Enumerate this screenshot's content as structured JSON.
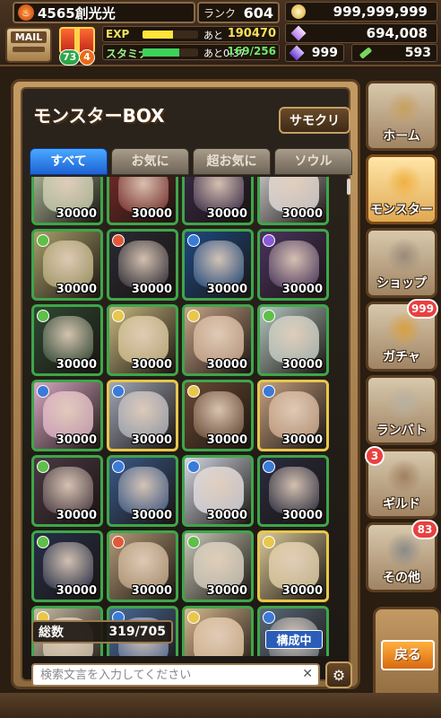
{
  "player": {
    "flame_icon": "flame-icon",
    "name": "4565創光光",
    "rank_label": "ランク",
    "rank": "604"
  },
  "mail": {
    "label": "MAIL"
  },
  "gift": {
    "badge_green": "73",
    "badge_orange": "4"
  },
  "exp": {
    "label": "EXP",
    "ato": "あと",
    "remaining": "190470",
    "fill_fraction": 0.55
  },
  "stamina": {
    "label": "スタミナ",
    "timer": "あと0:37",
    "value": "169/256",
    "fill_fraction": 0.66
  },
  "currency": {
    "coins": "999,999,999",
    "gems": "694,008",
    "crystals": "999",
    "items": "593"
  },
  "panel": {
    "title": "モンスターBOX",
    "sort_button": "サモクリ"
  },
  "tabs": [
    {
      "label": "すべて",
      "active": true
    },
    {
      "label": "お気に",
      "active": false
    },
    {
      "label": "超お気に",
      "active": false
    },
    {
      "label": "ソウル",
      "active": false
    }
  ],
  "monsters": [
    {
      "value": "30000",
      "border": "#3ea64a",
      "elem": "#5fbf4a",
      "bg": "#b7c6a4"
    },
    {
      "value": "30000",
      "border": "#3ea64a",
      "elem": "#e05a3a",
      "bg": "#7a2c2a"
    },
    {
      "value": "30000",
      "border": "#3ea64a",
      "elem": "#8a5ad8",
      "bg": "#3a2a4a"
    },
    {
      "value": "30000",
      "border": "#3ea64a",
      "elem": "#e8c74a",
      "bg": "#d8d6d8"
    },
    {
      "value": "30000",
      "border": "#3ea64a",
      "elem": "#5fbf4a",
      "bg": "#a8a06a"
    },
    {
      "value": "30000",
      "border": "#3ea64a",
      "elem": "#e05a3a",
      "bg": "#2a2a34"
    },
    {
      "value": "30000",
      "border": "#3ea64a",
      "elem": "#3a7ad8",
      "bg": "#1e4a82"
    },
    {
      "value": "30000",
      "border": "#3ea64a",
      "elem": "#8a5ad8",
      "bg": "#4a3460"
    },
    {
      "value": "30000",
      "border": "#3ea64a",
      "elem": "#5fbf4a",
      "bg": "#2e4a34"
    },
    {
      "value": "30000",
      "border": "#3ea64a",
      "elem": "#e8c74a",
      "bg": "#c8b880"
    },
    {
      "value": "30000",
      "border": "#3ea64a",
      "elem": "#e8c74a",
      "bg": "#c8a488"
    },
    {
      "value": "30000",
      "border": "#3ea64a",
      "elem": "#5fbf4a",
      "bg": "#b4c6c0"
    },
    {
      "value": "30000",
      "border": "#3ea64a",
      "elem": "#3a7ad8",
      "bg": "#d8a8c4"
    },
    {
      "value": "30000",
      "border": "#e8c74a",
      "elem": "#3a7ad8",
      "bg": "#a0a8b8"
    },
    {
      "value": "30000",
      "border": "#3ea64a",
      "elem": "#e8c74a",
      "bg": "#6a4a34"
    },
    {
      "value": "30000",
      "border": "#e8c74a",
      "elem": "#3a7ad8",
      "bg": "#c4a080"
    },
    {
      "value": "30000",
      "border": "#3ea64a",
      "elem": "#5fbf4a",
      "bg": "#4a3a44"
    },
    {
      "value": "30000",
      "border": "#3ea64a",
      "elem": "#3a7ad8",
      "bg": "#3a5a8a"
    },
    {
      "value": "30000",
      "border": "#3ea64a",
      "elem": "#3a7ad8",
      "bg": "#d4d8e4"
    },
    {
      "value": "30000",
      "border": "#3ea64a",
      "elem": "#3a7ad8",
      "bg": "#2a2c40"
    },
    {
      "value": "30000",
      "border": "#3ea64a",
      "elem": "#5fbf4a",
      "bg": "#26304a"
    },
    {
      "value": "30000",
      "border": "#3ea64a",
      "elem": "#e05a3a",
      "bg": "#b49a78"
    },
    {
      "value": "30000",
      "border": "#3ea64a",
      "elem": "#5fbf4a",
      "bg": "#c8c8b8"
    },
    {
      "value": "30000",
      "border": "#e8c74a",
      "elem": "#e8c74a",
      "bg": "#d8c898"
    },
    {
      "value": "",
      "border": "#3ea64a",
      "elem": "#e8c74a",
      "bg": "#c8bca4"
    },
    {
      "value": "",
      "border": "#3ea64a",
      "elem": "#3a7ad8",
      "bg": "#4a6a9a"
    },
    {
      "value": "",
      "border": "#3ea64a",
      "elem": "#e8c74a",
      "bg": "#d8b890"
    },
    {
      "value": "",
      "border": "#3ea64a",
      "elem": "#3a7ad8",
      "bg": "#5a6a7a",
      "tag": "構成中"
    }
  ],
  "total": {
    "label": "総数",
    "value": "319/705"
  },
  "search": {
    "placeholder": "検索文言を入力してください",
    "clear_icon": "close-icon",
    "settings_icon": "gear-icon"
  },
  "nav": [
    {
      "label": "ホーム",
      "icon": "home-icon",
      "badge": ""
    },
    {
      "label": "モンスター",
      "icon": "monster-icon",
      "badge": "",
      "active": true
    },
    {
      "label": "ショップ",
      "icon": "shop-icon",
      "badge": ""
    },
    {
      "label": "ガチャ",
      "icon": "gacha-icon",
      "badge": "999"
    },
    {
      "label": "ランバト",
      "icon": "versus-icon",
      "badge": ""
    },
    {
      "label": "ギルド",
      "icon": "guild-icon",
      "badge": "3"
    },
    {
      "label": "その他",
      "icon": "gear-icon",
      "badge": "83"
    }
  ],
  "back": {
    "label": "戻る"
  }
}
